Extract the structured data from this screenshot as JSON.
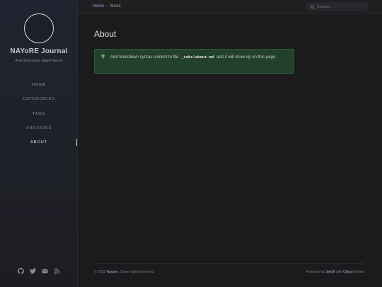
{
  "sidebar": {
    "title": "NAYoRE Journal",
    "subtitle": "A text-focused Jekyll theme",
    "nav": [
      {
        "label": "HOME",
        "active": false
      },
      {
        "label": "CATEGORIES",
        "active": false
      },
      {
        "label": "TAGS",
        "active": false
      },
      {
        "label": "ARCHIVES",
        "active": false
      },
      {
        "label": "ABOUT",
        "active": true
      }
    ],
    "icons": [
      "github-icon",
      "twitter-icon",
      "email-icon",
      "rss-icon"
    ]
  },
  "topbar": {
    "breadcrumb_home": "Home",
    "breadcrumb_sep": "›",
    "breadcrumb_current": "About",
    "search_placeholder": "Search..."
  },
  "main": {
    "title": "About",
    "prompt": {
      "text_before": "Add Markdown syntax content to file",
      "code": "_tabs/about.md",
      "text_after": "and it will show up on this page."
    }
  },
  "footer": {
    "copyright_prefix": "© 2022",
    "owner": "Nayore",
    "rights": ". Some rights reserved.",
    "powered_by": "Powered by",
    "engine": "Jekyll",
    "with": "with",
    "theme": "Chirpy",
    "theme_suffix": "theme."
  },
  "colors": {
    "sidebar_bg": "#202330",
    "main_bg": "#1b1b1e",
    "prompt_bg": "#23402b",
    "link": "#8fa8d8"
  }
}
